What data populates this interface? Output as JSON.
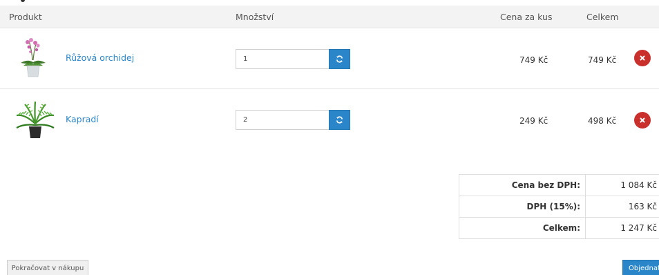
{
  "table_header": {
    "product": "Produkt",
    "quantity": "Množství",
    "unit_price": "Cena za kus",
    "total": "Celkem"
  },
  "items": [
    {
      "name": "Růžová orchidej",
      "quantity": "1",
      "unit_price": "749 Kč",
      "total": "749 Kč",
      "image_icon": "orchid-image"
    },
    {
      "name": "Kapradí",
      "quantity": "2",
      "unit_price": "249 Kč",
      "total": "498 Kč",
      "image_icon": "fern-image"
    }
  ],
  "summary": [
    {
      "label": "Cena bez DPH:",
      "value": "1 084 Kč"
    },
    {
      "label": "DPH (15%):",
      "value": "163 Kč"
    },
    {
      "label": "Celkem:",
      "value": "1 247 Kč"
    }
  ],
  "buttons": {
    "continue_label": "Pokračovat v nákupu",
    "order_label": "Objednat"
  },
  "colors": {
    "accent": "#2a86c8",
    "remove": "#c9302c"
  },
  "icons": {
    "refresh": "refresh-icon",
    "remove": "remove-icon"
  }
}
